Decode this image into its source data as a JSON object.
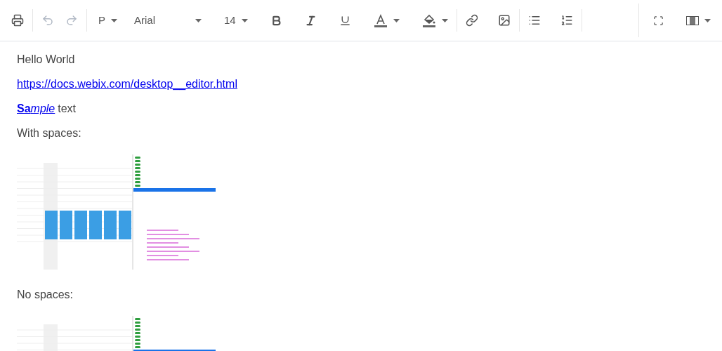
{
  "toolbar": {
    "undo": {
      "disabled": true
    },
    "redo": {
      "disabled": true
    },
    "block_format": "P",
    "font_family": "Arial",
    "font_size": "14"
  },
  "document": [
    {
      "kind": "text",
      "text": "Hello World"
    },
    {
      "kind": "link",
      "text": "https://docs.webix.com/desktop__editor.html"
    },
    {
      "kind": "mixed",
      "link_parts": [
        "**Sa**",
        "*mple*"
      ],
      "text": "text"
    },
    {
      "kind": "text",
      "text": "With spaces:"
    },
    {
      "kind": "image"
    },
    {
      "kind": "text",
      "text": "No spaces:"
    },
    {
      "kind": "image"
    }
  ]
}
